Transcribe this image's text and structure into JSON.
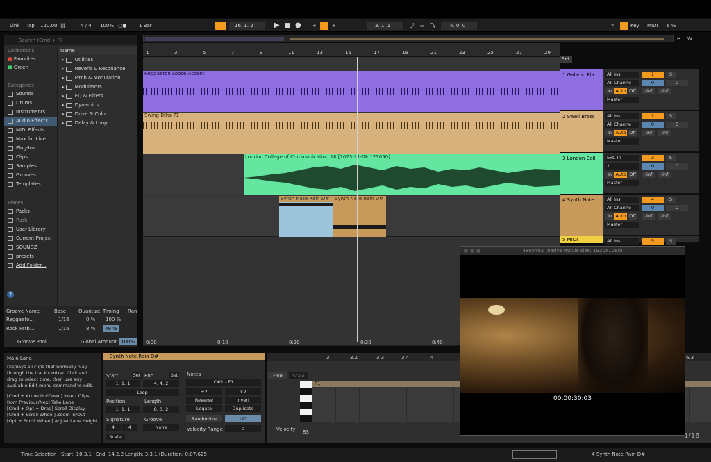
{
  "toolbar": {
    "link": "Link",
    "tap": "Tap",
    "tempo": "120.00",
    "signature": "4 / 4",
    "zoom": "100%",
    "quantize": "1 Bar",
    "position": "16. 1. 2",
    "loop_start": "3. 1. 1",
    "loop_length": "4. 0. 0",
    "key": "Key",
    "midi": "MIDI",
    "cpu": "6 %"
  },
  "browser": {
    "search_placeholder": "Search (Cmd + F)",
    "collections_label": "Collections",
    "collections": [
      "Favorites",
      "Green"
    ],
    "categories_label": "Categories",
    "categories": [
      "Sounds",
      "Drums",
      "Instruments",
      "Audio Effects",
      "MIDI Effects",
      "Max for Live",
      "Plug-Ins",
      "Clips",
      "Samples",
      "Grooves",
      "Templates"
    ],
    "places_label": "Places",
    "places": [
      "Packs",
      "Push",
      "User Library",
      "Current Projec",
      "SOUNDZ",
      "presets",
      "Add Folder..."
    ],
    "name_header": "Name",
    "items": [
      "Utilities",
      "Reverb & Resonance",
      "Pitch & Modulation",
      "Modulators",
      "EQ & Filters",
      "Dynamics",
      "Drive & Color",
      "Delay & Loop"
    ]
  },
  "groove": {
    "headers": [
      "Groove Name",
      "Base",
      "Quantize",
      "Timing",
      "Ran"
    ],
    "rows": [
      {
        "name": "Reggaeto...",
        "base": "1/16",
        "quantize": "0 %",
        "timing": "100 %"
      },
      {
        "name": "Rock Fatb...",
        "base": "1/16",
        "quantize": "8 %",
        "timing": "49 %"
      }
    ],
    "pool_label": "Groove Pool",
    "global_label": "Global Amount",
    "global_value": "100%"
  },
  "ruler": {
    "bars": [
      "1",
      "3",
      "5",
      "7",
      "9",
      "11",
      "13",
      "15",
      "17",
      "19",
      "21",
      "23",
      "25",
      "27",
      "29"
    ],
    "times": [
      "0:00",
      "0:10",
      "0:20",
      "0:30",
      "0:40"
    ]
  },
  "tracks": [
    {
      "name": "1 Galleon Pia",
      "color": "#8e6ee0",
      "clip": "Reggaeton Loose Accent",
      "input": "All Ins",
      "channel": "All Channe",
      "num": "1",
      "vol": "0",
      "pan": "C"
    },
    {
      "name": "2 Swell Brass",
      "color": "#d8b27c",
      "clip": "Swing Bths 71",
      "input": "All Ins",
      "channel": "All Channe",
      "num": "2",
      "vol": "0",
      "pan": "C"
    },
    {
      "name": "3 London Coll",
      "color": "#64e6a0",
      "clip": "London College of Communication 18 [2023-11-08 123050]",
      "input": "Ext. In",
      "channel": "1",
      "num": "3",
      "vol": "0",
      "pan": "C"
    },
    {
      "name": "4 Synth Note",
      "color": "#c79a5c",
      "clip": "Synth Note Rain D#",
      "input": "All Ins",
      "channel": "All Channe",
      "num": "4",
      "vol": "0",
      "pan": "C"
    },
    {
      "name": "5 MIDI",
      "color": "#f0d040",
      "clip": "",
      "input": "All Ins",
      "channel": "",
      "num": "5",
      "vol": "",
      "pan": ""
    }
  ],
  "mixer_labels": {
    "in": "In",
    "auto": "Auto",
    "off": "Off",
    "inf": "-inf",
    "master": "Master",
    "s": "S",
    "set": "Set"
  },
  "info": {
    "title": "Main Lane",
    "body": "Displays all clips that normally play through the track's mixer. Click and drag to select time, then use any available Edit menu command to edit.",
    "tips": [
      "[Cmd + Arrow Up/Down] Insert Clips from Previous/Next Take Lane",
      "[Cmd + Opt + Drag] Scroll Display",
      "[Cmd + Scroll Wheel] Zoom In/Out",
      "[Opt + Scroll Wheel] Adjust Lane Height"
    ]
  },
  "clip_view": {
    "title": "Synth Note Rain D#",
    "start_label": "Start",
    "end_label": "End",
    "set": "Set",
    "start": "1. 1. 1",
    "end": "4. 4. 2",
    "loop": "Loop",
    "position_label": "Position",
    "length_label": "Length",
    "position": "1. 1. 1",
    "length": "8. 0. 2",
    "signature_label": "Signature",
    "groove_label": "Groove",
    "sig_num": "4",
    "sig_den": "4",
    "groove": "None",
    "scale": "Scale",
    "notes_label": "Notes",
    "range": "C#1 - F1",
    "plus2": "+2",
    "x2": "×2",
    "reverse": "Reverse",
    "invert": "Invert",
    "legato": "Legato",
    "duplicate": "Duplicate",
    "randomize": "Randomize",
    "rand_value": "127",
    "vel_range": "Velocity Range",
    "vel_value": "0"
  },
  "midi_editor": {
    "fold": "Fold",
    "scale": "Scale",
    "key": "F1",
    "velocity": "Velocity",
    "vel_value": "83",
    "bars": [
      "3",
      "3.2",
      "3.3",
      "3.4",
      "4",
      "6.3"
    ]
  },
  "video": {
    "title": "480x402 (native movie size: 1920x1080)",
    "timecode": "00:00:30:03"
  },
  "status": {
    "mode": "Time Selection",
    "start": "Start: 10.3.1",
    "end": "End: 14.2.2",
    "length": "Length: 3.3.1 (Duration: 0:07:625)",
    "clip": "4-Synth Note Rain D#"
  },
  "page_num": "1/16"
}
